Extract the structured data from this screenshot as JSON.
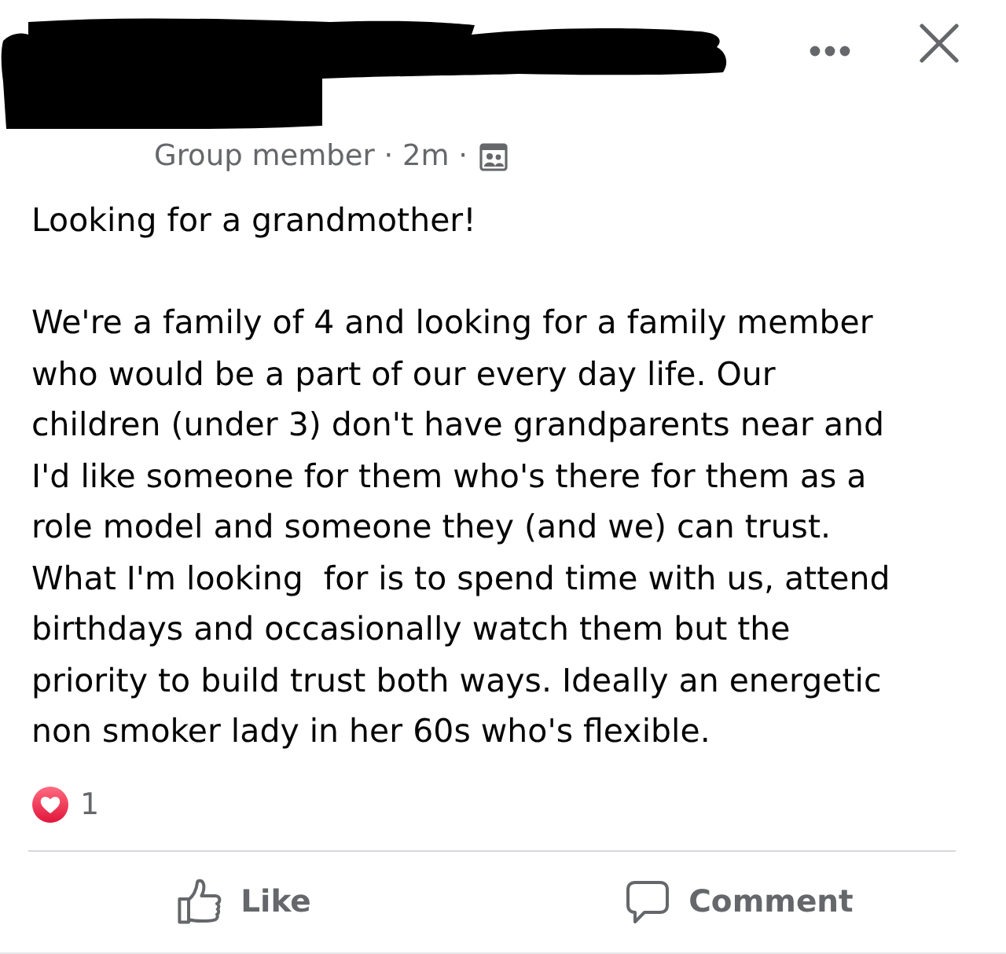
{
  "header": {
    "byline": "Group member · 2m ·"
  },
  "post": {
    "title": "Looking for a grandmother!",
    "body": "We're a family of 4 and looking for a family member\nwho would be a part of our every day life. Our\nchildren (under 3) don't have grandparents near and\nI'd like someone for them who's there for them as a\nrole model and someone they (and we) can trust.\nWhat I'm looking  for is to spend time with us, attend\nbirthdays and occasionally watch them but the\npriority to build trust both ways. Ideally an energetic\nnon smoker lady in her 60s who's flexible."
  },
  "reactions": {
    "count": "1"
  },
  "actions": [
    {
      "kind": "like",
      "label": "Like"
    },
    {
      "kind": "comment",
      "label": "Comment"
    }
  ]
}
